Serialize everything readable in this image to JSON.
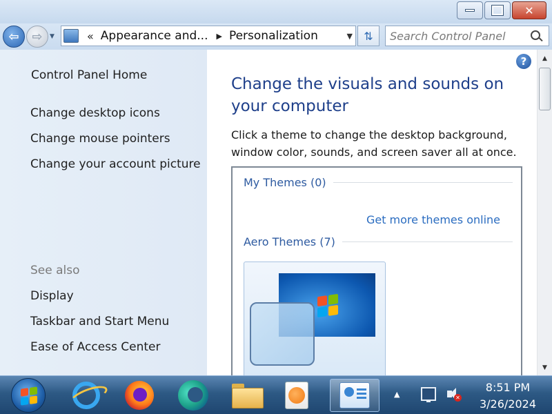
{
  "window": {
    "minimize_icon": "minimize-icon",
    "maximize_icon": "restore-icon",
    "close_symbol": "✕"
  },
  "nav": {
    "back_symbol": "⇦",
    "forward_symbol": "⇨",
    "breadcrumb_overflow": "«",
    "breadcrumb": [
      "Appearance and...",
      "Personalization"
    ],
    "search_placeholder": "Search Control Panel"
  },
  "sidebar": {
    "home": "Control Panel Home",
    "links": [
      "Change desktop icons",
      "Change mouse pointers",
      "Change your account picture"
    ],
    "see_also_heading": "See also",
    "see_also": [
      "Display",
      "Taskbar and Start Menu",
      "Ease of Access Center"
    ]
  },
  "main": {
    "heading": "Change the visuals and sounds on your computer",
    "description": "Click a theme to change the desktop background, window color, sounds, and screen saver all at once.",
    "groups": [
      {
        "label": "My Themes (0)"
      },
      {
        "label": "Aero Themes (7)"
      }
    ],
    "get_more_link": "Get more themes online",
    "help_symbol": "?"
  },
  "taskbar": {
    "pinned": [
      {
        "name": "internet-explorer",
        "icon": "ie-icon"
      },
      {
        "name": "firefox",
        "icon": "firefox-icon"
      },
      {
        "name": "edge",
        "icon": "edge-icon"
      },
      {
        "name": "windows-explorer",
        "icon": "folder-icon"
      },
      {
        "name": "media-player",
        "icon": "media-player-icon"
      },
      {
        "name": "control-panel",
        "icon": "control-panel-icon",
        "active": true
      }
    ],
    "tray_expand": "▲",
    "time": "8:51 PM",
    "date": "3/26/2024"
  },
  "colors": {
    "heading": "#1e3f8a",
    "link": "#2a6cc0",
    "group_label": "#2d5aa0",
    "windows_logo": [
      "#f35325",
      "#81bc06",
      "#05a6f0",
      "#ffba08"
    ]
  }
}
